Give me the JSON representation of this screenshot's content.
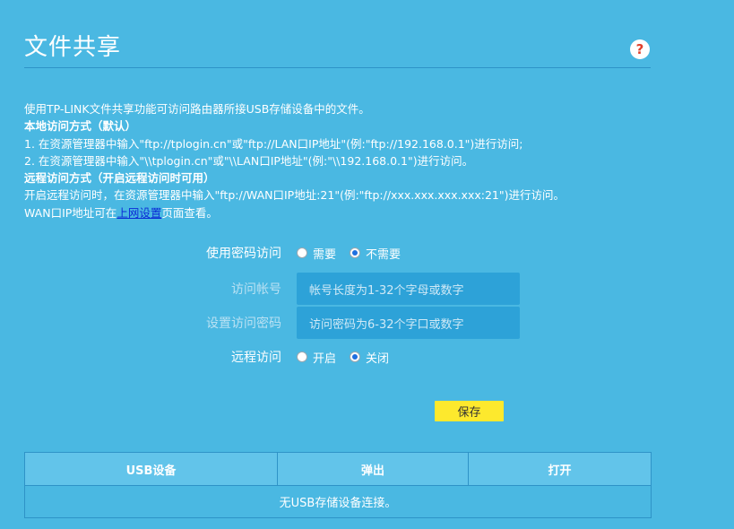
{
  "page": {
    "title": "文件共享",
    "help_icon": "?"
  },
  "description": {
    "line1": "使用TP-LINK文件共享功能可访问路由器所接USB存储设备中的文件。",
    "local_heading": "本地访问方式（默认）",
    "local1": "1. 在资源管理器中输入\"ftp://tplogin.cn\"或\"ftp://LAN口IP地址\"(例:\"ftp://192.168.0.1\")进行访问;",
    "local2": "2. 在资源管理器中输入\"\\\\tplogin.cn\"或\"\\\\LAN口IP地址\"(例:\"\\\\192.168.0.1\")进行访问。",
    "remote_heading": "远程访问方式（开启远程访问时可用）",
    "remote1": "开启远程访问时，在资源管理器中输入\"ftp://WAN口IP地址:21\"(例:\"ftp://xxx.xxx.xxx.xxx:21\")进行访问。",
    "remote2_prefix": "WAN口IP地址可在",
    "remote2_link": "上网设置",
    "remote2_suffix": "页面查看。"
  },
  "form": {
    "password_access": {
      "label": "使用密码访问",
      "options": [
        "需要",
        "不需要"
      ],
      "selected": "不需要"
    },
    "account": {
      "label": "访问帐号",
      "placeholder": "帐号长度为1-32个字母或数字",
      "value": ""
    },
    "password": {
      "label": "设置访问密码",
      "placeholder": "访问密码为6-32个字口或数字",
      "value": ""
    },
    "remote_access": {
      "label": "远程访问",
      "options": [
        "开启",
        "关闭"
      ],
      "selected": "关闭"
    },
    "save_label": "保存"
  },
  "usb_table": {
    "headers": [
      "USB设备",
      "弹出",
      "打开"
    ],
    "empty_message": "无USB存储设备连接。"
  },
  "colors": {
    "background": "#4ab8e2",
    "save_button": "#fde92d",
    "help_icon": "#e0402c"
  }
}
